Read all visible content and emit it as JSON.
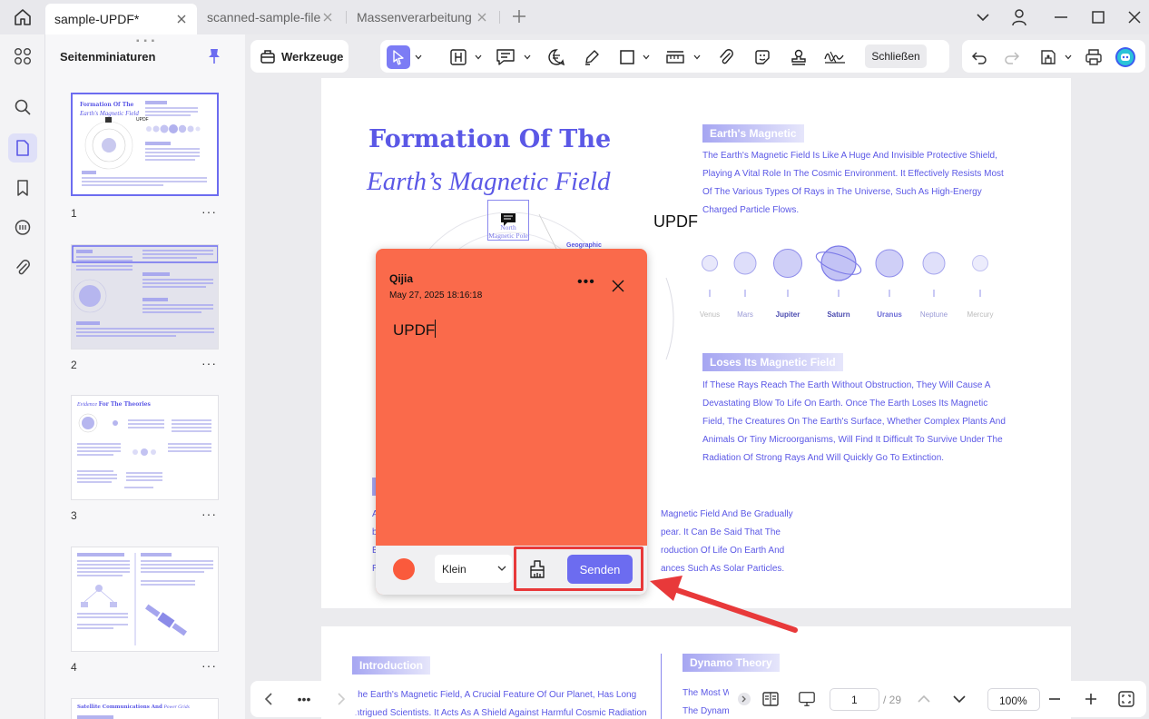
{
  "tabs": [
    {
      "label": "sample-UPDF*",
      "active": true
    },
    {
      "label": "scanned-sample-file",
      "active": false
    },
    {
      "label": "Massenverarbeitung",
      "active": false
    }
  ],
  "sidebar": {
    "title": "Seitenminiaturen",
    "thumbnails": [
      {
        "number": "1",
        "title": "Formation Of The",
        "subtitle": "Earth's Magnetic Field"
      },
      {
        "number": "2"
      },
      {
        "number": "3",
        "title_italic": "Evidence",
        "title_rest": "For The Theories"
      },
      {
        "number": "4"
      },
      {
        "title": "Satellite Communications And",
        "title_italic": "Power Grids"
      }
    ],
    "more_label": "···"
  },
  "toolbar": {
    "tools_label": "Werkzeuge",
    "close_label": "Schließen"
  },
  "document": {
    "title_line1": "Formation Of The",
    "title_line2": "Earth’s Magnetic Field",
    "callout_label": "North Magnetic Pole",
    "geographic_label": "Geographic",
    "stamp_text": "UPDF",
    "section1_heading": "Earth's Magnetic",
    "section1_lines": [
      "The Earth's Magnetic Field Is Like A Huge And Invisible Protective Shield,",
      "Playing A Vital Role In The Cosmic Environment. It Effectively Resists Most",
      "Of The Various Types Of Rays in The Universe, Such As High-Energy",
      "Charged Particle Flows."
    ],
    "planets": [
      "Venus",
      "Mars",
      "Jupiter",
      "Saturn",
      "Uranus",
      "Neptune",
      "Mercury"
    ],
    "section2_heading": "Loses Its Magnetic Field",
    "section2_lines": [
      "If These Rays Reach The Earth Without Obstruction, They Will Cause A",
      "Devastating Blow To Life On Earth. Once The Earth Loses Its Magnetic",
      "Field, The Creatures On The Earth's Surface, Whether Complex Plants And",
      "Animals Or Tiny Microorganisms, Will Find It Difficult To Survive Under The",
      "Radiation Of Strong Rays And Will Quickly Go To Extinction."
    ],
    "partial_lines": [
      "Magnetic Field And Be Gradually",
      "pear. It Can Be Said That The",
      "roduction Of Life On Earth And",
      "ances Such As Solar Particles."
    ],
    "page2_heading_left": "Introduction",
    "page2_heading_right": "Dynamo Theory",
    "page2_left_lines": [
      "The Earth's Magnetic Field, A Crucial Feature Of Our Planet, Has Long",
      "Intrigued Scientists. It Acts As A Shield Against Harmful Cosmic Radiation"
    ],
    "page2_right_lines": [
      "The Most W",
      "The Dynam"
    ]
  },
  "note": {
    "author": "Qijia",
    "date": "May 27, 2025 18:16:18",
    "text": "UPDF",
    "size_option": "Klein",
    "send_label": "Senden",
    "note_color": "#fa6a4b"
  },
  "pagination": {
    "current_page": "1",
    "total_pages": "/ 29",
    "zoom": "100%"
  },
  "colors": {
    "accent": "#6c6cf0",
    "highlight": "#e8393a"
  }
}
